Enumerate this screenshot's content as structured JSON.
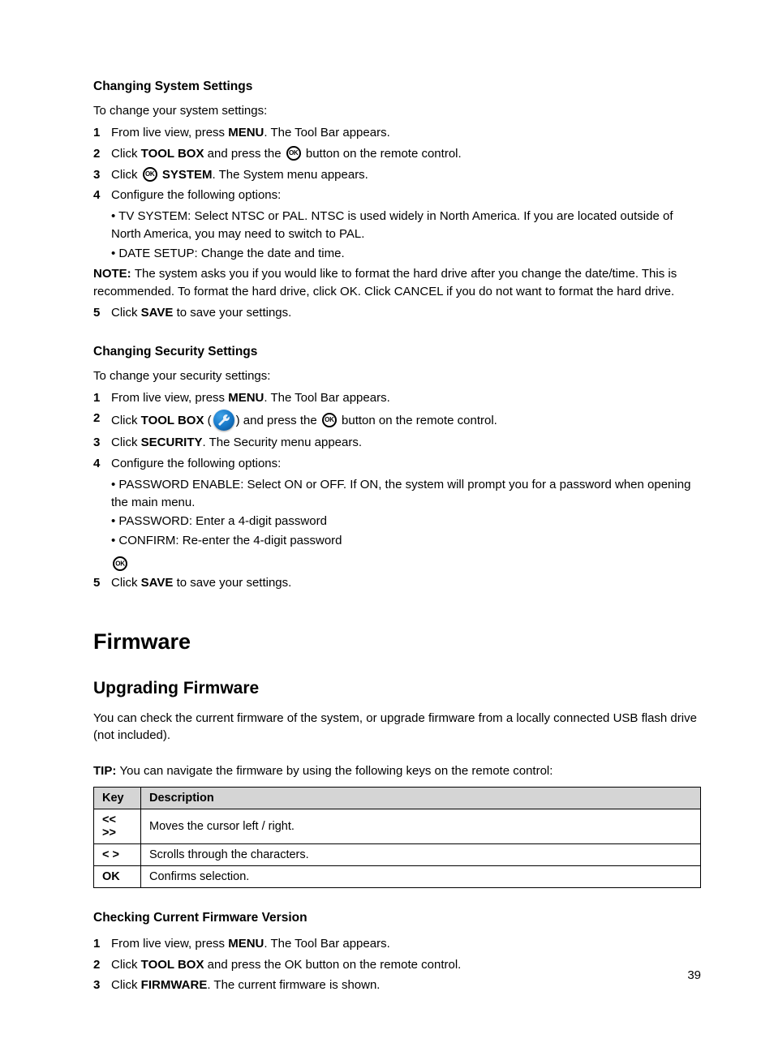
{
  "section_system": {
    "title": "Changing System Settings",
    "intro": "To change your system settings:",
    "steps": [
      {
        "n": "1",
        "pre": "From live view, press ",
        "bold": "MENU",
        "post": ". The Tool Bar appears."
      },
      {
        "n": "2",
        "pre": "Click ",
        "bold": "TOOL BOX",
        "mid": " and press the ",
        "icon": "ok",
        "post": " button on the remote control."
      },
      {
        "n": "3",
        "pre": "Click ",
        "bold": "SYSTEM",
        "post": ". The System menu appears."
      },
      {
        "n": "4",
        "pre": "Configure the following options:",
        "post": ""
      }
    ],
    "substep_tvsystem": {
      "bold": "TV SYSTEM",
      "text": ": Select NTSC or PAL. NTSC is used widely in North America. If you are located outside of North America, you may need to switch to PAL."
    },
    "substep_date": {
      "bold": "DATE SETUP",
      "text": ": Change the date and time."
    },
    "note": {
      "label": "NOTE: ",
      "text": "The system asks you if you would like to format the hard drive after you change the date/time. This is recommended. To format the hard drive, click OK. Click CANCEL if you do not want to format the hard drive."
    },
    "step5": {
      "n": "5",
      "pre": "Click ",
      "bold": "SAVE",
      "post": " to save your settings."
    }
  },
  "section_security": {
    "title": "Changing Security Settings",
    "intro": "To change your security settings:",
    "steps": [
      {
        "n": "1",
        "pre": "From live view, press ",
        "bold": "MENU",
        "post": ". The Tool Bar appears."
      },
      {
        "n": "2",
        "pre": "Click ",
        "bold": "TOOL BOX",
        "mid": " (",
        "icon": "tool",
        "mid2": ") and press the ",
        "icon2": "ok",
        "post": " button on the remote control."
      },
      {
        "n": "3",
        "pre": "Click ",
        "bold": "SECURITY",
        "post": ". The Security menu appears."
      },
      {
        "n": "4",
        "pre": "Configure the following options:",
        "post": ""
      }
    ],
    "substeps": [
      {
        "bold": "PASSWORD ENABLE",
        "text": ": Select ON or OFF. If ON, the system will prompt you for a password when opening the main menu."
      },
      {
        "bold": "PASSWORD",
        "text": ": Enter a 4-digit password"
      },
      {
        "bold": "CONFIRM",
        "text": ": Re-enter the 4-digit password"
      }
    ],
    "step5": {
      "n": "5",
      "pre": "Click ",
      "bold": "SAVE",
      "post": " to save your settings."
    }
  },
  "section_firmware": {
    "title": "Firmware",
    "subtitle": "Upgrading Firmware",
    "body": "You can check the current firmware of the system, or upgrade firmware from a locally connected USB flash drive (not included).",
    "tip_label": "TIP: ",
    "tip_text": "You can navigate the firmware by using the following keys on the remote control:",
    "table": {
      "headers": [
        "Key",
        "Description"
      ],
      "rows": [
        {
          "key": "<< >>",
          "desc": "Moves the cursor left / right."
        },
        {
          "key": "< >",
          "desc": "Scrolls through the characters."
        },
        {
          "key": "OK",
          "desc": "Confirms selection."
        }
      ]
    },
    "checking_title": "Checking Current Firmware Version",
    "steps": [
      {
        "n": "1",
        "pre": "From live view, press ",
        "bold": "MENU",
        "post": ". The Tool Bar appears."
      },
      {
        "n": "2",
        "pre": "Click ",
        "bold": "TOOL BOX",
        "post": " and press the OK button on the remote control."
      },
      {
        "n": "3",
        "pre": "Click ",
        "bold": "FIRMWARE",
        "post": ". The current firmware is shown."
      }
    ]
  },
  "footer": {
    "page": "39"
  }
}
